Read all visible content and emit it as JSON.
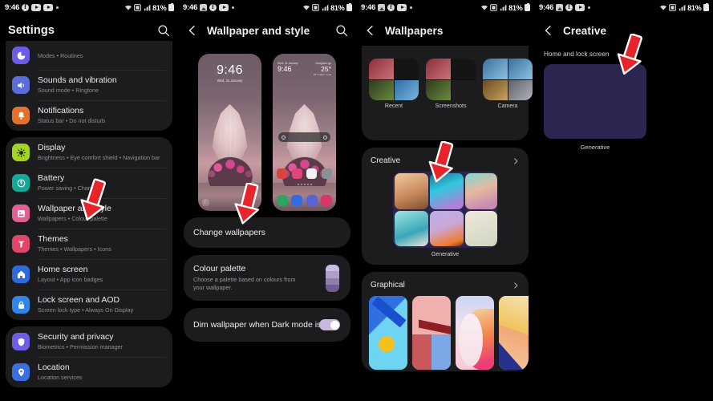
{
  "status_bar": {
    "time": "9:46",
    "battery_text": "81%",
    "icons": [
      "gallery-icon",
      "facebook-icon",
      "youtube-icon",
      "dot-icon",
      "wifi-icon",
      "sim-icon",
      "signal-icon",
      "battery-icon"
    ]
  },
  "panel1": {
    "title": "Settings",
    "search_icon": "search-icon",
    "groups": [
      {
        "items": [
          {
            "title": "",
            "subtitle": "Modes  •  Routines",
            "icon": "modes-icon",
            "color": "#6b5ce7"
          },
          {
            "title": "Sounds and vibration",
            "subtitle": "Sound mode  •  Ringtone",
            "icon": "speaker-icon",
            "color": "#5b6ddb"
          },
          {
            "title": "Notifications",
            "subtitle": "Status bar  •  Do not disturb",
            "icon": "bell-icon",
            "color": "#e0722c"
          }
        ]
      },
      {
        "items": [
          {
            "title": "Display",
            "subtitle": "Brightness  •  Eye comfort shield  •  Navigation bar",
            "icon": "brightness-icon",
            "color": "#a4d321"
          },
          {
            "title": "Battery",
            "subtitle": "Power saving  •  Charging",
            "icon": "battery-circle-icon",
            "color": "#12a89a"
          },
          {
            "title": "Wallpaper and style",
            "subtitle": "Wallpapers  •  Colour palette",
            "icon": "wallpaper-icon",
            "color": "#e05f95"
          },
          {
            "title": "Themes",
            "subtitle": "Themes  •  Wallpapers  •  Icons",
            "icon": "themes-icon",
            "color": "#e0456b"
          },
          {
            "title": "Home screen",
            "subtitle": "Layout  •  App icon badges",
            "icon": "home-icon",
            "color": "#2d6ae0"
          },
          {
            "title": "Lock screen and AOD",
            "subtitle": "Screen lock type  •  Always On Display",
            "icon": "lock-icon",
            "color": "#2f86e8"
          }
        ]
      },
      {
        "items": [
          {
            "title": "Security and privacy",
            "subtitle": "Biometrics  •  Permission manager",
            "icon": "shield-icon",
            "color": "#6d5ee6"
          },
          {
            "title": "Location",
            "subtitle": "Location services",
            "icon": "location-icon",
            "color": "#3a6fe0"
          }
        ]
      }
    ]
  },
  "panel2": {
    "title": "Wallpaper and style",
    "back_icon": "back-arrow-icon",
    "search_icon": "search-icon",
    "lock_preview": {
      "time": "9:46",
      "date": "Wed, 31 January"
    },
    "home_preview": {
      "date": "Wed, 31 January",
      "time": "9:46",
      "time_suffix": "am",
      "weather_label": "Gangnam-gu",
      "temperature": "25°",
      "weather_sub": "29 / Index • Low"
    },
    "change_wallpapers": "Change wallpapers",
    "colour_palette": {
      "title": "Colour palette",
      "subtitle": "Choose a palette based on colours from your wallpaper.",
      "swatches": [
        "#c9bce0",
        "#ada0c4",
        "#8e7fae",
        "#6f5f90"
      ]
    },
    "dim_wallpaper": {
      "label": "Dim wallpaper when Dark mode is on",
      "enabled": true,
      "accent": "#c9b8dd"
    }
  },
  "panel3": {
    "title": "Wallpapers",
    "back_icon": "back-arrow-icon",
    "sources": [
      {
        "label": "Recent"
      },
      {
        "label": "Screenshots"
      },
      {
        "label": "Camera"
      }
    ],
    "sections": [
      {
        "header": "Creative",
        "chevron": "chevron-right-icon",
        "item_label": "Generative"
      },
      {
        "header": "Graphical",
        "chevron": "chevron-right-icon"
      }
    ]
  },
  "panel4": {
    "title": "Creative",
    "back_icon": "back-arrow-icon",
    "section_label": "Home and lock screen",
    "item_label": "Generative"
  },
  "annotations": {
    "arrow_color": "#e8242a",
    "arrows": [
      {
        "target": "wallpaper-and-style-row"
      },
      {
        "target": "change-wallpapers-button"
      },
      {
        "target": "creative-generative-tile"
      },
      {
        "target": "creative-home-and-lock-tile"
      }
    ]
  }
}
